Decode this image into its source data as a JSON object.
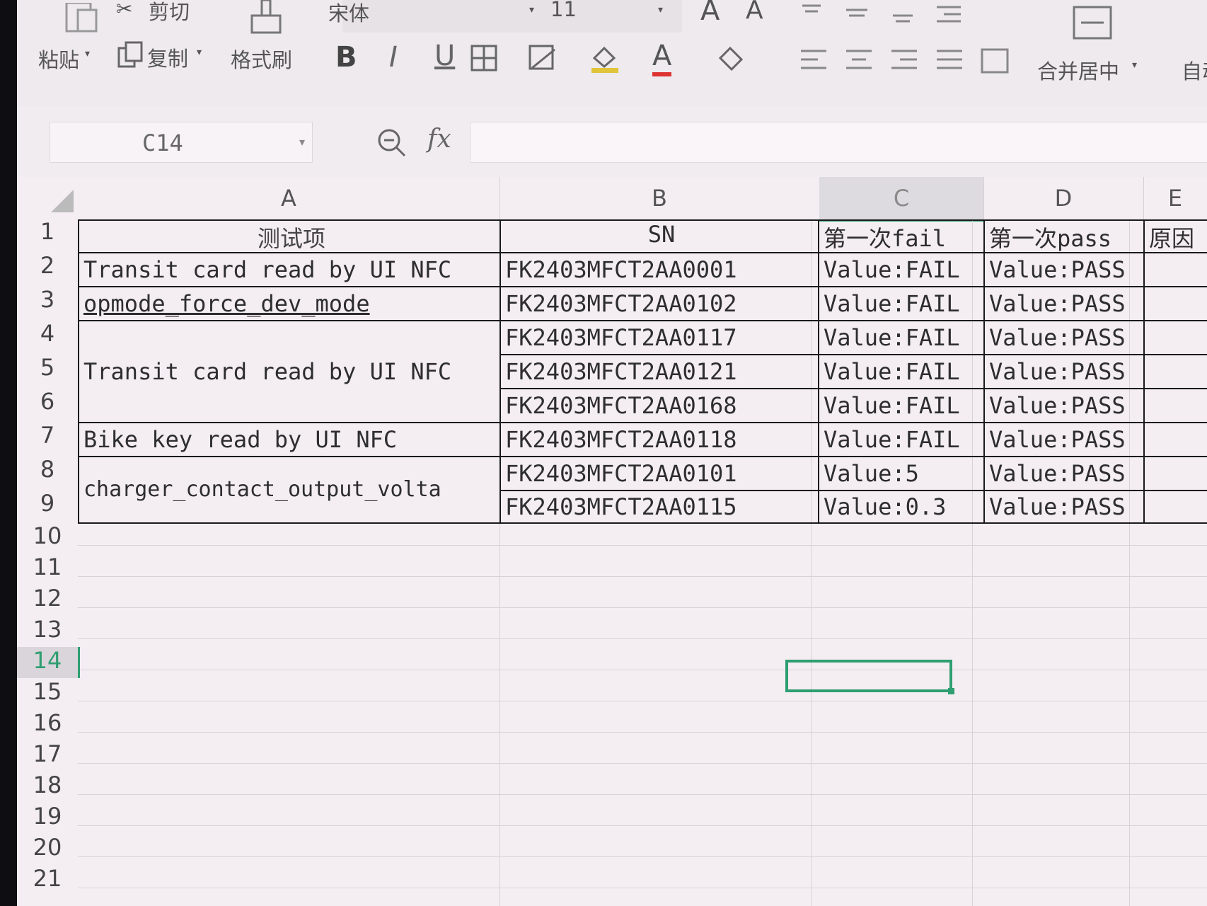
{
  "toolbar": {
    "cut": "剪切",
    "paste": "粘贴",
    "copy": "复制",
    "format_painter": "格式刷",
    "font_name": "宋体",
    "font_size": "11",
    "bold": "B",
    "italic": "I",
    "underline": "U",
    "font_color": "A",
    "merge_center": "合并居中",
    "auto_wrap": "自动"
  },
  "formula_bar": {
    "cell_ref": "C14",
    "fx": "fx",
    "value": ""
  },
  "columns": [
    "A",
    "B",
    "C",
    "D",
    "E"
  ],
  "selected_column": "C",
  "rows": [
    "1",
    "2",
    "3",
    "4",
    "5",
    "6",
    "7",
    "8",
    "9",
    "10",
    "11",
    "12",
    "13",
    "14",
    "15",
    "16",
    "17",
    "18",
    "19",
    "20",
    "21"
  ],
  "selected_row": "14",
  "table": {
    "headers": {
      "a": "测试项",
      "b": "SN",
      "c": "第一次fail",
      "d": "第一次pass",
      "e": "原因"
    },
    "test_items": [
      "Transit card read by UI NFC",
      "opmode_force_dev_mode",
      "Transit card read by UI NFC",
      "Bike key read by UI NFC",
      "charger_contact_output_volta"
    ],
    "records": [
      {
        "sn": "FK2403MFCT2AA0001",
        "fail": "Value:FAIL",
        "pass": "Value:PASS"
      },
      {
        "sn": "FK2403MFCT2AA0102",
        "fail": "Value:FAIL",
        "pass": "Value:PASS"
      },
      {
        "sn": "FK2403MFCT2AA0117",
        "fail": "Value:FAIL",
        "pass": "Value:PASS"
      },
      {
        "sn": "FK2403MFCT2AA0121",
        "fail": "Value:FAIL",
        "pass": "Value:PASS"
      },
      {
        "sn": "FK2403MFCT2AA0168",
        "fail": "Value:FAIL",
        "pass": "Value:PASS"
      },
      {
        "sn": "FK2403MFCT2AA0118",
        "fail": "Value:FAIL",
        "pass": "Value:PASS"
      },
      {
        "sn": "FK2403MFCT2AA0101",
        "fail": "Value:5",
        "pass": "Value:PASS"
      },
      {
        "sn": "FK2403MFCT2AA0115",
        "fail": "Value:0.3",
        "pass": "Value:PASS"
      }
    ]
  }
}
